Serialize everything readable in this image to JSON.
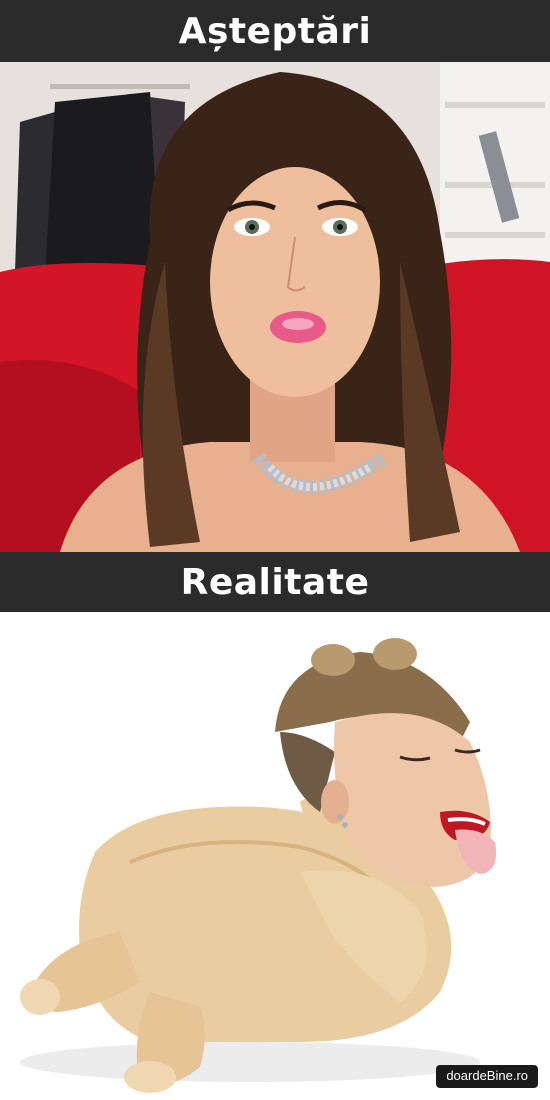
{
  "captions": {
    "top": "Așteptări",
    "middle": "Realitate"
  },
  "photos": {
    "expectation_icon": "selfie-photo",
    "reality_icon": "chicken-collage-photo"
  },
  "watermark": {
    "text": "doardeBine.ro"
  },
  "colors": {
    "banner_bg": "#2b2b2b",
    "banner_text": "#ffffff",
    "sofa_red": "#d8182b",
    "lips_pink": "#e85a8a",
    "chicken_skin": "#e9cda0"
  }
}
